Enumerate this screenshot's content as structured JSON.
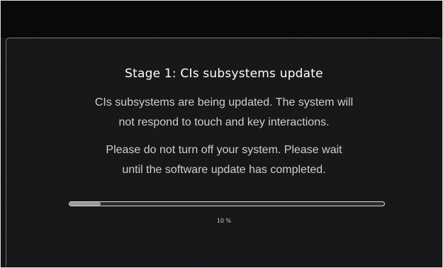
{
  "dialog": {
    "title": "Stage 1: CIs subsystems update",
    "line1": "CIs subsystems are being updated. The system will",
    "line2": "not respond to touch and key interactions.",
    "line3": "Please do not turn off your system. Please wait",
    "line4": "until the software update has completed."
  },
  "progress": {
    "fraction": 0.1,
    "label": "10 %"
  },
  "colors": {
    "background": "#111213",
    "text": "#cfcfcf",
    "title": "#ffffff",
    "progress_border": "#d8d8d8",
    "progress_fill": "#9a9a9a"
  }
}
